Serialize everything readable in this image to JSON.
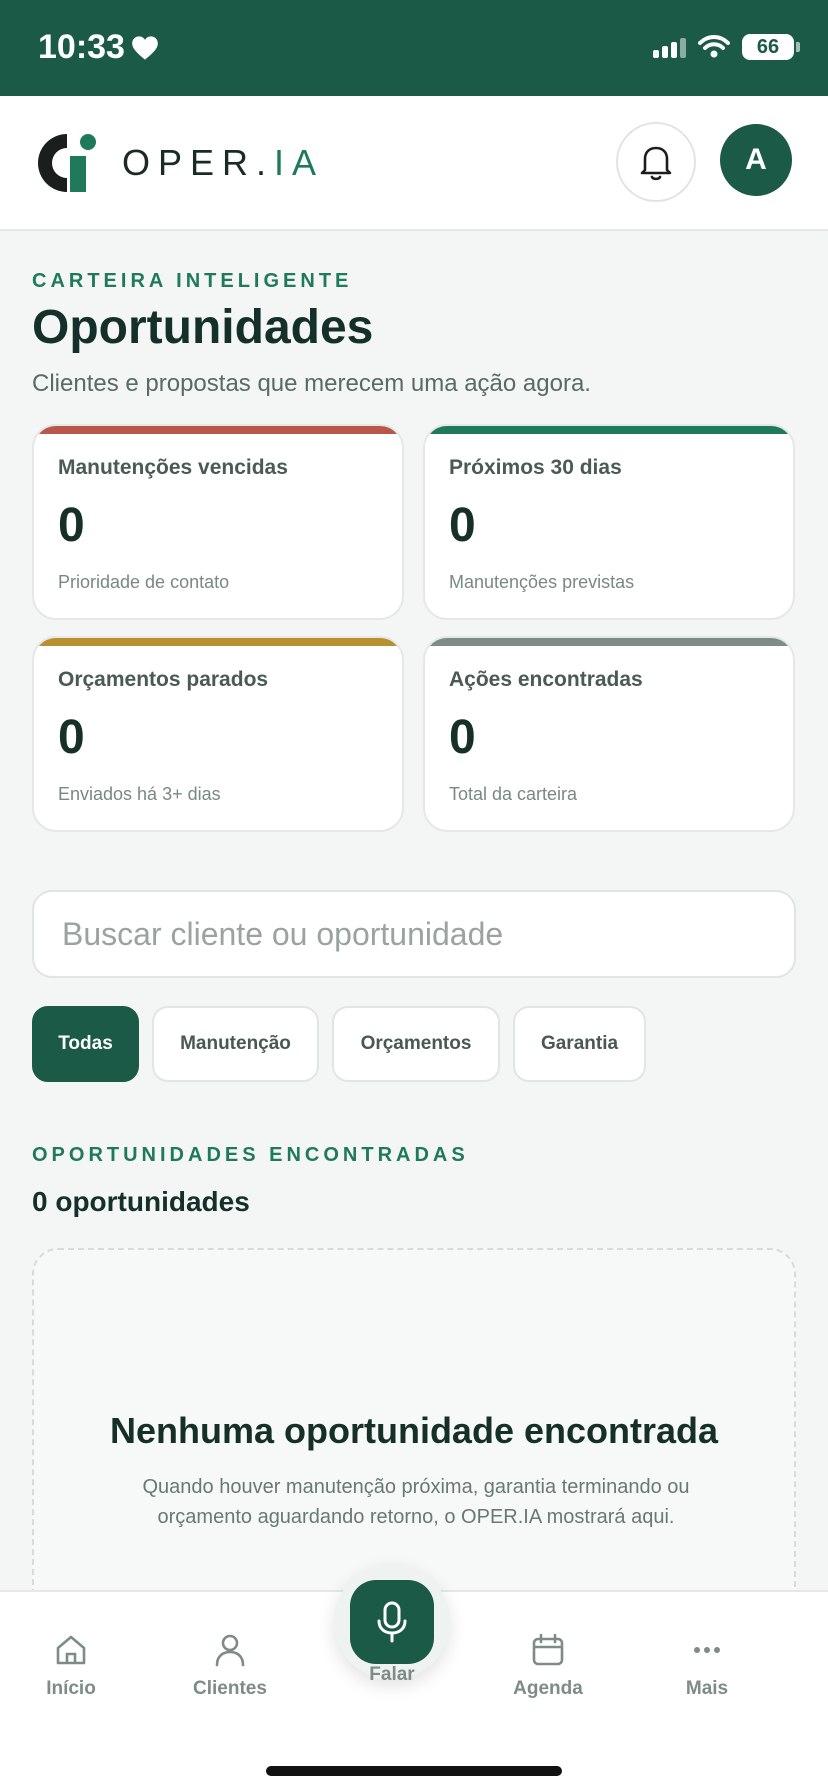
{
  "status_bar": {
    "time": "10:33",
    "battery": "66"
  },
  "header": {
    "brand_main": "OPER.",
    "brand_accent": "IA",
    "avatar_initial": "A"
  },
  "page": {
    "eyebrow": "CARTEIRA INTELIGENTE",
    "title": "Oportunidades",
    "subtitle": "Clientes e propostas que merecem uma ação agora."
  },
  "stats": [
    {
      "label": "Manutenções vencidas",
      "value": "0",
      "note": "Prioridade de contato",
      "color": "#b9574a"
    },
    {
      "label": "Próximos 30 dias",
      "value": "0",
      "note": "Manutenções previstas",
      "color": "#1f7a5c"
    },
    {
      "label": "Orçamentos parados",
      "value": "0",
      "note": "Enviados há 3+ dias",
      "color": "#b8902f"
    },
    {
      "label": "Ações encontradas",
      "value": "0",
      "note": "Total da carteira",
      "color": "#7f8b87"
    }
  ],
  "search": {
    "placeholder": "Buscar cliente ou oportunidade"
  },
  "filters": [
    "Todas",
    "Manutenção",
    "Orçamentos",
    "Garantia"
  ],
  "results": {
    "eyebrow": "OPORTUNIDADES ENCONTRADAS",
    "count": "0 oportunidades",
    "empty_title": "Nenhuma oportunidade encontrada",
    "empty_desc": "Quando houver manutenção próxima, garantia terminando ou orçamento aguardando retorno, o OPER.IA mostrará aqui."
  },
  "nav": {
    "home": "Início",
    "clients": "Clientes",
    "talk": "Falar",
    "agenda": "Agenda",
    "more": "Mais"
  }
}
